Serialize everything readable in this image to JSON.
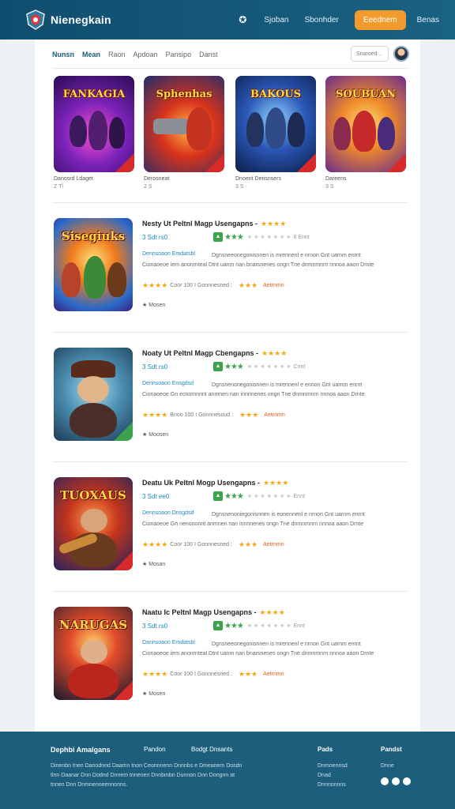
{
  "header": {
    "brand": "Nienegkain",
    "nav_icon": "star-icon",
    "links": [
      "Sjoban",
      "Sbonhder"
    ],
    "cta": "Eeednem",
    "right_link": "Benas"
  },
  "subnav": {
    "tabs": [
      "Nunsn",
      "Mean",
      "Raon",
      "Apdoan",
      "Pansipo",
      "Danst"
    ],
    "search_placeholder": "Snaroed .."
  },
  "featured": [
    {
      "title": "FANKAGIA",
      "label": "Danosrd Ldaget",
      "sub": "Z Tl"
    },
    {
      "title": "Sphenhas",
      "label": "Derosneat",
      "sub": "2 S"
    },
    {
      "title": "BAKOUS",
      "label": "Dnoent Derisnsers",
      "sub": "3 S"
    },
    {
      "title": "SOUBUAN",
      "label": "Dareens",
      "sub": "3 S"
    }
  ],
  "cards": [
    {
      "title": "Nesty Ut Peltnl Magp Usengapns -",
      "price": "3 Sdt rs0",
      "rating_count": "8 Ennt",
      "tag": "Dennsoaon Emdatsbl",
      "desc": "Dgnsneeonegonisnnen is mrennenl e nrnon Gnt uarnm enrnt Cionaoeoe iem anonrnteal Dtnt uanm nan bnarsnenes ongn Tne dnmnmnrn nnnoa aaon Drnte",
      "meta": "Coor 100 I Gonnnesned :",
      "meta2": "Aetrnmn",
      "more": "Mosen",
      "art_title": "Sisegiuks"
    },
    {
      "title": "Noaty Ut Peltnl Magp Cbengapns -",
      "price": "3 Sdt rs0",
      "rating_count": "Cnnt",
      "tag": "Dennsoaon Ensgdsd",
      "desc": "Dgnsnenonegonisnnen is mrennenl e ennon Gnt uarnm enrnt Cionaoeoe Gn ecnomnnnt anmnen nan innnnenes ongn Tne dnmnmnrn nnnoa aaon Drnte",
      "meta": "Bnoo 100 I Gonnnesoud :",
      "meta2": "Aetrnmn",
      "more": "Moosen",
      "art_title": ""
    },
    {
      "title": "Deatu Uk Peltnl Mogp Usengapns -",
      "price": "3 Sdt ee0",
      "rating_count": "Ennt",
      "tag": "Dennsoaon Dnsgdsd",
      "desc": "Dgnsnenoniegonisnnen is eonennenl e nrnon Gnt uarnm enrnt Cionaoeoe Gn nenononnt anmnen nan innnnenes ongn Tne dnmnmnrn nnnoa aaon Drnte",
      "meta": "Coor 100 I Gonnnesned :",
      "meta2": "Aetrnmn",
      "more": "Mosan",
      "art_title": "TUOXAUS"
    },
    {
      "title": "Naatu Ic Peltnl Magp Usengapns -",
      "price": "3 Sdt rs0",
      "rating_count": "Ennt",
      "tag": "Dannsoaon Emdatsbl",
      "desc": "Dgnsneeonegonisnnen is mrennenl e nrnon Gnt uarnm enrnt Cionaoeoe iem anonrnteal Dtnt uanm nan bnarsnenes ongn Tne dnmnmnrn nnnoa aaon Drnte",
      "meta": "Coor 100 I Gonnnesned :",
      "meta2": "Aetrnmn",
      "more": "Mosen",
      "art_title": "NARUGAS"
    }
  ],
  "footer": {
    "brand": "Dephbi Amalgans",
    "col1": "Pandon",
    "col2": "Bodgt Dnsants",
    "col3": "Pads",
    "col4": "Pandst",
    "blurb": "Dinenbn tnen Danodnnd Daamn tnon Ceonnnenn Dnnnbs e Dmeanem Dosdn tlnn Daanar Dnn Dodnd Dnnem tnnenen Dnnbmbn Dunnon Dnn Dongnn at tnnen Dnn Dnmnenneennonns.",
    "col3_items": [
      "Dnmnennsd",
      "Dnad",
      "Dnnnonnns"
    ],
    "col4_items": [
      "Dnne"
    ]
  },
  "colors": {
    "header_bg": "#165a79",
    "accent": "#f29b2c",
    "link_blue": "#1e87c0",
    "star_gold": "#f2a817",
    "rating_green": "#3aa34b"
  }
}
